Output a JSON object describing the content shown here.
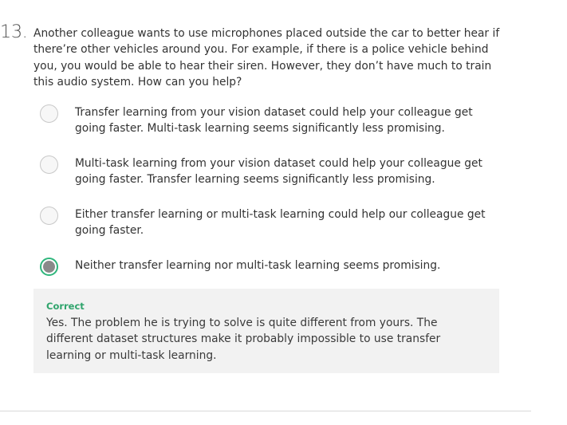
{
  "question": {
    "number": "13.",
    "text": "Another colleague wants to use microphones placed outside the car to better hear if there’re other vehicles around you. For example, if there is a police vehicle behind you, you would be able to hear their siren. However, they don’t have much to train this audio system. How can you help?"
  },
  "options": [
    {
      "label": "Transfer learning from your vision dataset could help your colleague get going faster. Multi-task learning seems significantly less promising.",
      "selected": false
    },
    {
      "label": "Multi-task learning from your vision dataset could help your colleague get going faster. Transfer learning seems significantly less promising.",
      "selected": false
    },
    {
      "label": "Either transfer learning or multi-task learning could help our colleague get going faster.",
      "selected": false
    },
    {
      "label": "Neither transfer learning nor multi-task learning seems promising.",
      "selected": true
    }
  ],
  "feedback": {
    "status": "Correct",
    "text": "Yes. The problem he is trying to solve is quite different from yours. The different dataset structures make it probably impossible to use transfer learning or multi-task learning."
  },
  "colors": {
    "correct_accent": "#2fb67c",
    "feedback_bg": "#f2f2f2"
  }
}
